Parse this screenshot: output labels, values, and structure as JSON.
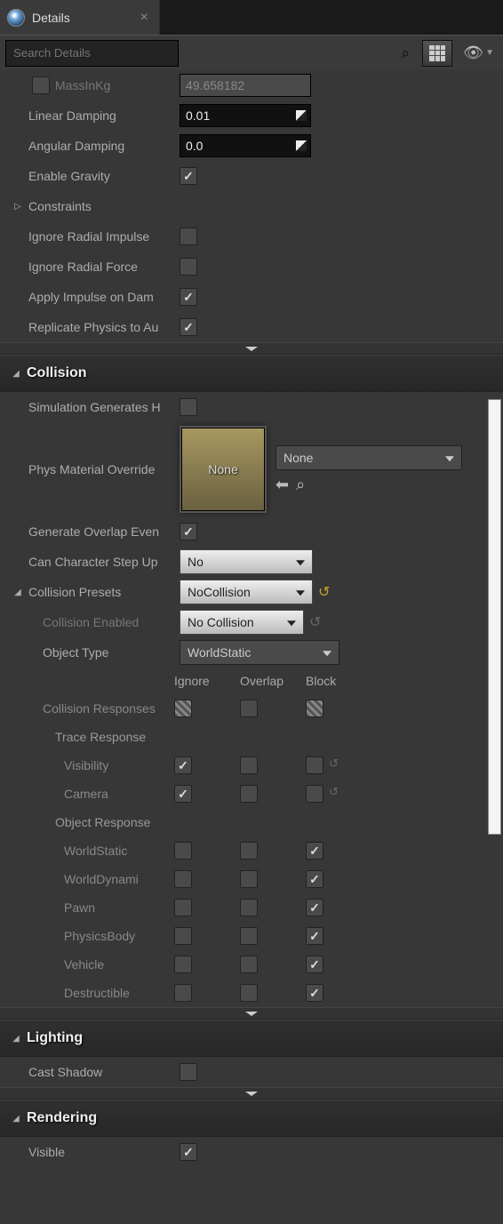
{
  "tab": {
    "title": "Details"
  },
  "search": {
    "placeholder": "Search Details"
  },
  "physics": {
    "massInKg": {
      "label": "MassInKg",
      "value": "49.658182"
    },
    "linearDamping": {
      "label": "Linear Damping",
      "value": "0.01"
    },
    "angularDamping": {
      "label": "Angular Damping",
      "value": "0.0"
    },
    "enableGravity": {
      "label": "Enable Gravity",
      "checked": true
    },
    "constraints": {
      "label": "Constraints"
    },
    "ignoreRadialImpulse": {
      "label": "Ignore Radial Impulse",
      "checked": false
    },
    "ignoreRadialForce": {
      "label": "Ignore Radial Force",
      "checked": false
    },
    "applyImpulseOnDamage": {
      "label": "Apply Impulse on Dam",
      "checked": true
    },
    "replicatePhysics": {
      "label": "Replicate Physics to Au",
      "checked": true
    }
  },
  "collision": {
    "title": "Collision",
    "simGenHits": {
      "label": "Simulation Generates H",
      "checked": false
    },
    "physMatOverride": {
      "label": "Phys Material Override",
      "thumb": "None",
      "dropdown": "None"
    },
    "genOverlap": {
      "label": "Generate Overlap Even",
      "checked": true
    },
    "canStepUp": {
      "label": "Can Character Step Up",
      "value": "No"
    },
    "presets": {
      "label": "Collision Presets",
      "value": "NoCollision"
    },
    "enabled": {
      "label": "Collision Enabled",
      "value": "No Collision"
    },
    "objectType": {
      "label": "Object Type",
      "value": "WorldStatic"
    },
    "respHeaders": [
      "Ignore",
      "Overlap",
      "Block"
    ],
    "collisionResponses": "Collision Responses",
    "traceResponses": "Trace Response",
    "trace": [
      {
        "label": "Visibility",
        "ignore": true,
        "overlap": false,
        "block": false
      },
      {
        "label": "Camera",
        "ignore": true,
        "overlap": false,
        "block": false
      }
    ],
    "objectResponses": "Object Response",
    "object": [
      {
        "label": "WorldStatic",
        "ignore": false,
        "overlap": false,
        "block": true
      },
      {
        "label": "WorldDynami",
        "ignore": false,
        "overlap": false,
        "block": true
      },
      {
        "label": "Pawn",
        "ignore": false,
        "overlap": false,
        "block": true
      },
      {
        "label": "PhysicsBody",
        "ignore": false,
        "overlap": false,
        "block": true
      },
      {
        "label": "Vehicle",
        "ignore": false,
        "overlap": false,
        "block": true
      },
      {
        "label": "Destructible",
        "ignore": false,
        "overlap": false,
        "block": true
      }
    ]
  },
  "lighting": {
    "title": "Lighting",
    "castShadow": {
      "label": "Cast Shadow",
      "checked": false
    }
  },
  "rendering": {
    "title": "Rendering",
    "visible": {
      "label": "Visible",
      "checked": true
    }
  }
}
